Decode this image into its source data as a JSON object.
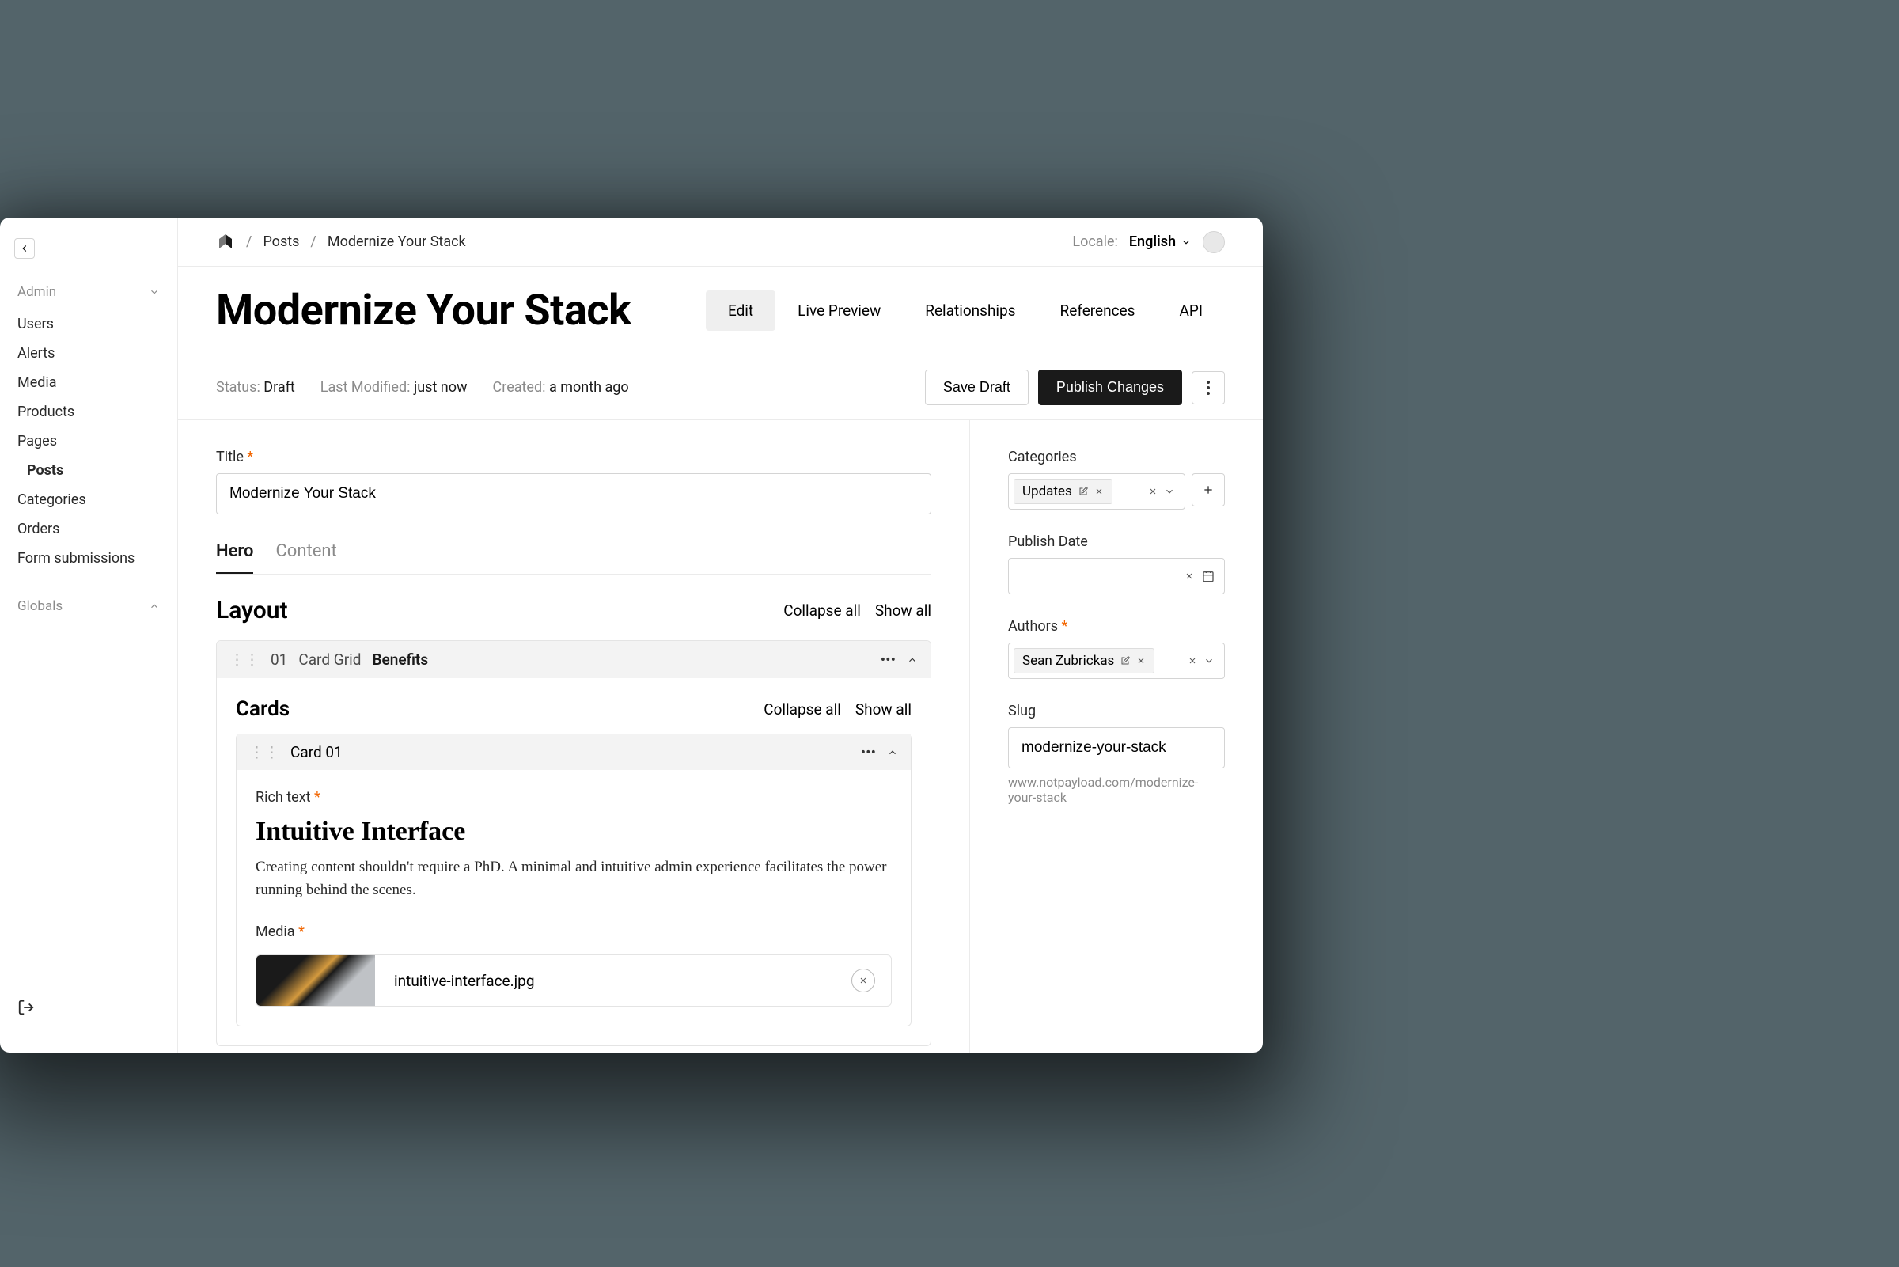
{
  "breadcrumb": {
    "root": "Posts",
    "current": "Modernize Your Stack"
  },
  "locale": {
    "label": "Locale:",
    "value": "English"
  },
  "sidebar": {
    "sections": {
      "admin": {
        "label": "Admin",
        "items": [
          "Users",
          "Alerts",
          "Media",
          "Products",
          "Pages",
          "Posts",
          "Categories",
          "Orders",
          "Form submissions"
        ],
        "activeIndex": 5
      },
      "globals": {
        "label": "Globals"
      }
    }
  },
  "page": {
    "title": "Modernize Your Stack",
    "tabs": [
      "Edit",
      "Live Preview",
      "Relationships",
      "References",
      "API"
    ],
    "activeTab": 0
  },
  "meta": {
    "status_label": "Status:",
    "status": "Draft",
    "modified_label": "Last Modified:",
    "modified": "just now",
    "created_label": "Created:",
    "created": "a month ago",
    "save_label": "Save Draft",
    "publish_label": "Publish Changes"
  },
  "fields": {
    "title_label": "Title",
    "title_value": "Modernize Your Stack",
    "subtabs": [
      "Hero",
      "Content"
    ],
    "activeSubtab": 0,
    "layout_label": "Layout",
    "collapse_all": "Collapse all",
    "show_all": "Show all"
  },
  "block": {
    "index": "01",
    "type": "Card Grid",
    "name": "Benefits",
    "cards_label": "Cards",
    "card": {
      "name": "Card 01",
      "richtext_label": "Rich text",
      "heading": "Intuitive Interface",
      "body": "Creating content shouldn't require a PhD. A minimal and intuitive admin experience facilitates the power running behind the scenes.",
      "media_label": "Media",
      "media_name": "intuitive-interface.jpg"
    }
  },
  "side": {
    "categories_label": "Categories",
    "category": "Updates",
    "publish_label": "Publish Date",
    "authors_label": "Authors",
    "author": "Sean Zubrickas",
    "slug_label": "Slug",
    "slug_value": "modernize-your-stack",
    "slug_url": "www.notpayload.com/modernize-your-stack"
  }
}
